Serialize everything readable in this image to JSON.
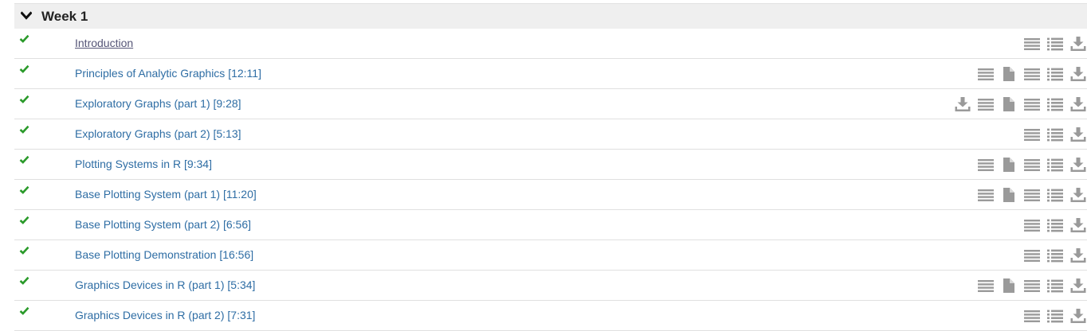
{
  "section": {
    "title": "Week 1",
    "toggle_icon": "chevron-down-icon"
  },
  "colors": {
    "link": "#2e6da4",
    "check": "#2a9a2a",
    "icon": "#999999",
    "header_bg": "#efefef"
  },
  "lectures": [
    {
      "title": "Introduction",
      "completed": true,
      "icons": [
        "lines-icon",
        "list-icon",
        "download-icon"
      ]
    },
    {
      "title": "Principles of Analytic Graphics [12:11]",
      "completed": true,
      "icons": [
        "lines-icon",
        "document-icon",
        "lines-icon",
        "list-icon",
        "download-icon"
      ]
    },
    {
      "title": "Exploratory Graphs (part 1) [9:28]",
      "completed": true,
      "icons": [
        "download-icon",
        "lines-icon",
        "document-icon",
        "lines-icon",
        "list-icon",
        "download-icon"
      ]
    },
    {
      "title": "Exploratory Graphs (part 2) [5:13]",
      "completed": true,
      "icons": [
        "lines-icon",
        "list-icon",
        "download-icon"
      ]
    },
    {
      "title": "Plotting Systems in R [9:34]",
      "completed": true,
      "icons": [
        "lines-icon",
        "document-icon",
        "lines-icon",
        "list-icon",
        "download-icon"
      ]
    },
    {
      "title": "Base Plotting System (part 1) [11:20]",
      "completed": true,
      "icons": [
        "lines-icon",
        "document-icon",
        "lines-icon",
        "list-icon",
        "download-icon"
      ]
    },
    {
      "title": "Base Plotting System (part 2) [6:56]",
      "completed": true,
      "icons": [
        "lines-icon",
        "list-icon",
        "download-icon"
      ]
    },
    {
      "title": "Base Plotting Demonstration [16:56]",
      "completed": true,
      "icons": [
        "lines-icon",
        "list-icon",
        "download-icon"
      ]
    },
    {
      "title": "Graphics Devices in R (part 1) [5:34]",
      "completed": true,
      "icons": [
        "lines-icon",
        "document-icon",
        "lines-icon",
        "list-icon",
        "download-icon"
      ]
    },
    {
      "title": "Graphics Devices in R (part 2) [7:31]",
      "completed": true,
      "icons": [
        "lines-icon",
        "list-icon",
        "download-icon"
      ]
    }
  ]
}
